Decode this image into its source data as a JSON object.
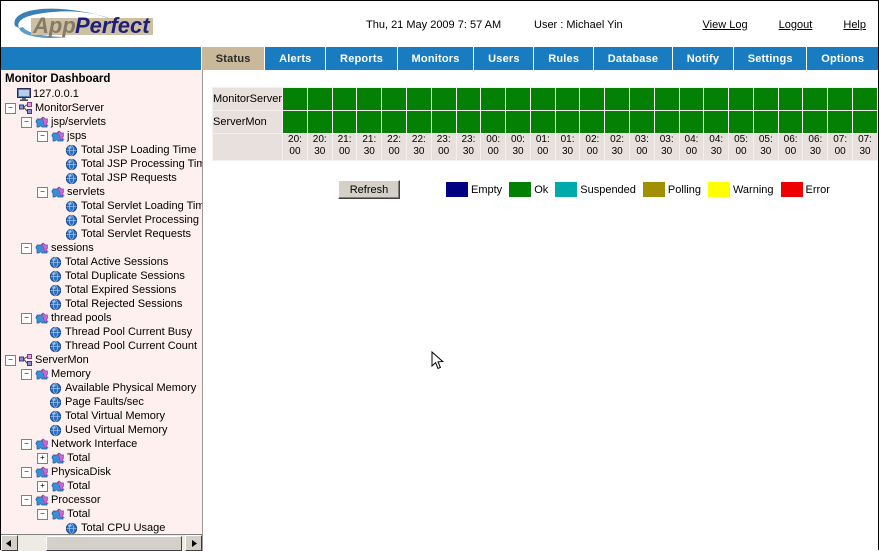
{
  "header": {
    "logo_app": "App",
    "logo_perfect": "Perfect",
    "date": "Thu, 21 May 2009 7: 57 AM",
    "user": "User : Michael Yin",
    "links": [
      {
        "label": "View Log",
        "name": "view-log-link"
      },
      {
        "label": "Logout",
        "name": "logout-link"
      },
      {
        "label": "Help",
        "name": "help-link"
      }
    ]
  },
  "nav": {
    "active": "Status",
    "tabs": [
      "Status",
      "Alerts",
      "Reports",
      "Monitors",
      "Users",
      "Rules",
      "Database",
      "Notify",
      "Settings",
      "Options"
    ]
  },
  "sidebar": {
    "title": "Monitor Dashboard",
    "tree": [
      {
        "label": "127.0.0.1",
        "depth": 0,
        "toggle": "none",
        "icon": "monitor-icon"
      },
      {
        "label": "MonitorServer",
        "depth": 0,
        "toggle": "expanded",
        "icon": "server-icon"
      },
      {
        "label": "jsp/servlets",
        "depth": 1,
        "toggle": "expanded",
        "icon": "puzzle-icon"
      },
      {
        "label": "jsps",
        "depth": 2,
        "toggle": "expanded",
        "icon": "puzzle-icon"
      },
      {
        "label": "Total JSP Loading Time",
        "depth": 3,
        "toggle": "none",
        "icon": "sphere-icon"
      },
      {
        "label": "Total JSP Processing Time",
        "depth": 3,
        "toggle": "none",
        "icon": "sphere-icon"
      },
      {
        "label": "Total JSP Requests",
        "depth": 3,
        "toggle": "none",
        "icon": "sphere-icon"
      },
      {
        "label": "servlets",
        "depth": 2,
        "toggle": "expanded",
        "icon": "puzzle-icon"
      },
      {
        "label": "Total Servlet Loading Time",
        "depth": 3,
        "toggle": "none",
        "icon": "sphere-icon"
      },
      {
        "label": "Total Servlet Processing Time",
        "depth": 3,
        "toggle": "none",
        "icon": "sphere-icon"
      },
      {
        "label": "Total Servlet Requests",
        "depth": 3,
        "toggle": "none",
        "icon": "sphere-icon"
      },
      {
        "label": "sessions",
        "depth": 1,
        "toggle": "expanded",
        "icon": "puzzle-icon"
      },
      {
        "label": "Total Active Sessions",
        "depth": 2,
        "toggle": "none",
        "icon": "sphere-icon"
      },
      {
        "label": "Total Duplicate Sessions",
        "depth": 2,
        "toggle": "none",
        "icon": "sphere-icon"
      },
      {
        "label": "Total Expired Sessions",
        "depth": 2,
        "toggle": "none",
        "icon": "sphere-icon"
      },
      {
        "label": "Total Rejected Sessions",
        "depth": 2,
        "toggle": "none",
        "icon": "sphere-icon"
      },
      {
        "label": "thread pools",
        "depth": 1,
        "toggle": "expanded",
        "icon": "puzzle-icon"
      },
      {
        "label": "Thread Pool Current Busy",
        "depth": 2,
        "toggle": "none",
        "icon": "sphere-icon"
      },
      {
        "label": "Thread Pool Current Count",
        "depth": 2,
        "toggle": "none",
        "icon": "sphere-icon"
      },
      {
        "label": "ServerMon",
        "depth": 0,
        "toggle": "expanded",
        "icon": "server-icon"
      },
      {
        "label": "Memory",
        "depth": 1,
        "toggle": "expanded",
        "icon": "puzzle-icon"
      },
      {
        "label": "Available Physical Memory",
        "depth": 2,
        "toggle": "none",
        "icon": "sphere-icon"
      },
      {
        "label": "Page Faults/sec",
        "depth": 2,
        "toggle": "none",
        "icon": "sphere-icon"
      },
      {
        "label": "Total Virtual Memory",
        "depth": 2,
        "toggle": "none",
        "icon": "sphere-icon"
      },
      {
        "label": "Used Virtual Memory",
        "depth": 2,
        "toggle": "none",
        "icon": "sphere-icon"
      },
      {
        "label": "Network Interface",
        "depth": 1,
        "toggle": "expanded",
        "icon": "puzzle-icon"
      },
      {
        "label": "Total",
        "depth": 2,
        "toggle": "collapsed",
        "icon": "puzzle-icon"
      },
      {
        "label": "PhysicaDisk",
        "depth": 1,
        "toggle": "expanded",
        "icon": "puzzle-icon"
      },
      {
        "label": "Total",
        "depth": 2,
        "toggle": "collapsed",
        "icon": "puzzle-icon"
      },
      {
        "label": "Processor",
        "depth": 1,
        "toggle": "expanded",
        "icon": "puzzle-icon"
      },
      {
        "label": "Total",
        "depth": 2,
        "toggle": "expanded",
        "icon": "puzzle-icon"
      },
      {
        "label": "Total CPU Usage",
        "depth": 3,
        "toggle": "none",
        "icon": "sphere-icon"
      }
    ]
  },
  "status_grid": {
    "rows": [
      {
        "label": "MonitorServer",
        "states": [
          "ok",
          "ok",
          "ok",
          "ok",
          "ok",
          "ok",
          "ok",
          "ok",
          "ok",
          "ok",
          "ok",
          "ok",
          "ok",
          "ok",
          "ok",
          "ok",
          "ok",
          "ok",
          "ok",
          "ok",
          "ok",
          "ok",
          "ok",
          "ok"
        ]
      },
      {
        "label": "ServerMon",
        "states": [
          "ok",
          "ok",
          "ok",
          "ok",
          "ok",
          "ok",
          "ok",
          "ok",
          "ok",
          "ok",
          "ok",
          "ok",
          "ok",
          "ok",
          "ok",
          "ok",
          "ok",
          "ok",
          "ok",
          "ok",
          "ok",
          "ok",
          "ok",
          "ok"
        ]
      }
    ],
    "times": [
      "20:00",
      "20:30",
      "21:00",
      "21:30",
      "22:00",
      "22:30",
      "23:00",
      "23:30",
      "00:00",
      "00:30",
      "01:00",
      "01:30",
      "02:00",
      "02:30",
      "03:00",
      "03:30",
      "04:00",
      "04:30",
      "05:00",
      "05:30",
      "06:00",
      "06:30",
      "07:00",
      "07:30"
    ]
  },
  "controls": {
    "refresh_label": "Refresh",
    "legend": [
      {
        "label": "Empty",
        "color": "#000080"
      },
      {
        "label": "Ok",
        "color": "#048004"
      },
      {
        "label": "Suspended",
        "color": "#00aaaa"
      },
      {
        "label": "Polling",
        "color": "#a09000"
      },
      {
        "label": "Warning",
        "color": "#ffff00"
      },
      {
        "label": "Error",
        "color": "#ee0000"
      }
    ]
  },
  "colors": {
    "nav_blue": "#1a7cc0",
    "active_tab": "#c9b99a",
    "ok_green": "#048004",
    "sidebar_bg": "#fdf0ee",
    "grid_label_bg": "#e8e0dc"
  }
}
